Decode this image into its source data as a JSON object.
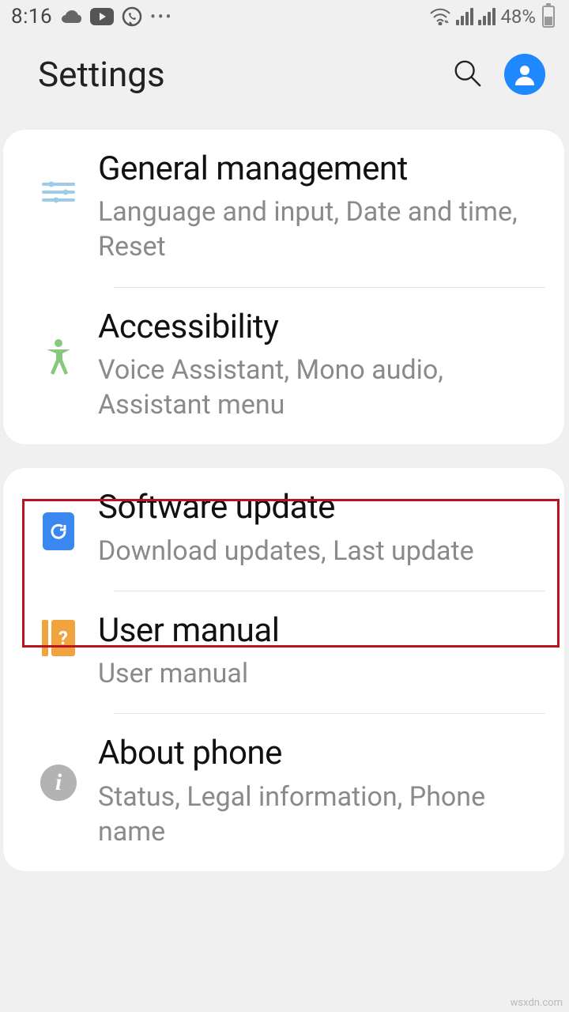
{
  "status": {
    "time": "8:16",
    "battery_pct": "48%"
  },
  "header": {
    "title": "Settings"
  },
  "groups": [
    {
      "id": "group1",
      "items": [
        {
          "title": "General management",
          "subtitle": "Language and input, Date and time, Reset"
        },
        {
          "title": "Accessibility",
          "subtitle": "Voice Assistant, Mono audio, Assistant menu"
        }
      ]
    },
    {
      "id": "group2",
      "items": [
        {
          "title": "Software update",
          "subtitle": "Download updates, Last update"
        },
        {
          "title": "User manual",
          "subtitle": "User manual"
        },
        {
          "title": "About phone",
          "subtitle": "Status, Legal information, Phone name"
        }
      ]
    }
  ],
  "watermark": "wsxdn.com"
}
